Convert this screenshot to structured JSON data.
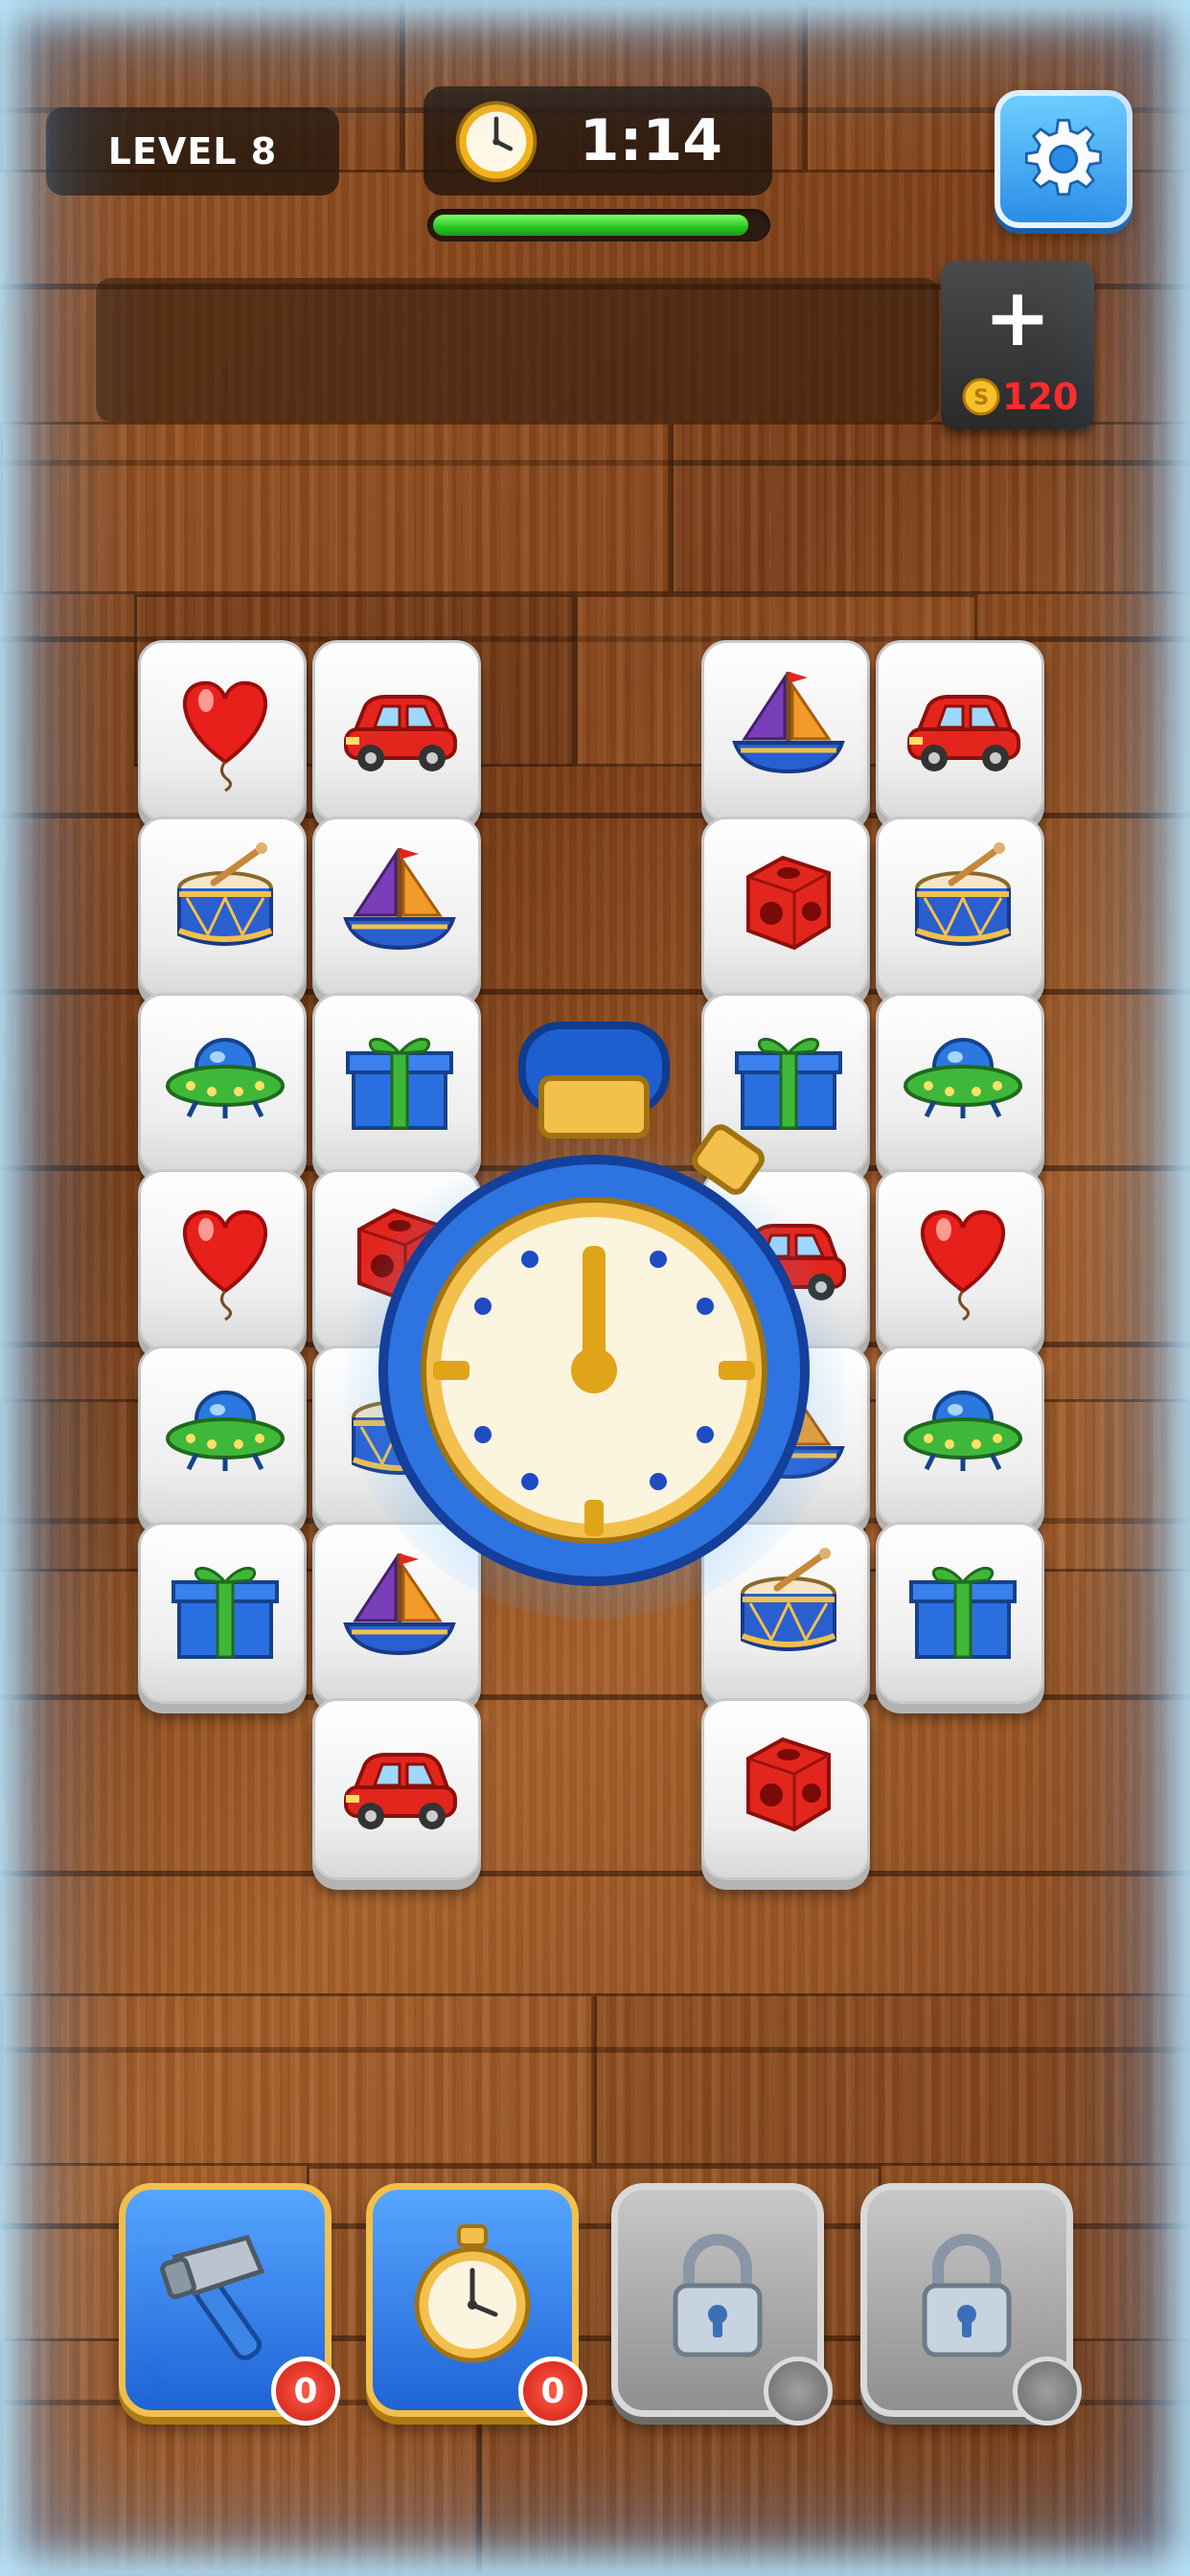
{
  "hud": {
    "level_label": "LEVEL 8",
    "timer_value": "1:14",
    "timer_progress": 0.95,
    "timer_icon": "clock-icon",
    "settings_icon": "gear-icon"
  },
  "slot_tray": {
    "add_slot_icon": "plus-icon",
    "coin_icon": "coin-icon",
    "coin_symbol": "S",
    "add_slot_cost": "120"
  },
  "board": {
    "left_grid": [
      [
        "heart-balloon",
        "red-car"
      ],
      [
        "drum",
        "sailboat"
      ],
      [
        "ufo",
        "gift-box"
      ],
      [
        "heart-balloon",
        "red-cube"
      ],
      [
        "ufo",
        "drum"
      ],
      [
        "gift-box",
        "sailboat"
      ],
      [
        null,
        "red-car"
      ]
    ],
    "right_grid": [
      [
        "sailboat",
        "red-car"
      ],
      [
        "red-cube",
        "drum"
      ],
      [
        "gift-box",
        "ufo"
      ],
      [
        "red-car",
        "heart-balloon"
      ],
      [
        "sailboat",
        "ufo"
      ],
      [
        "drum",
        "gift-box"
      ],
      [
        "red-cube",
        null
      ]
    ],
    "center_overlay": "stopwatch-freeze-icon"
  },
  "boosters": [
    {
      "name": "hammer",
      "icon": "hammer-icon",
      "count": "0",
      "locked": false
    },
    {
      "name": "freeze-time",
      "icon": "stopwatch-icon",
      "count": "0",
      "locked": false
    },
    {
      "name": "locked-1",
      "icon": "lock-icon",
      "count": "",
      "locked": true
    },
    {
      "name": "locked-2",
      "icon": "lock-icon",
      "count": "",
      "locked": true
    }
  ],
  "colors": {
    "timer_fill": "#27c421",
    "booster_blue": "#2f7ce8",
    "booster_border": "#f2c04b",
    "badge_red": "#d01e12",
    "cost_red": "#ff2a2a"
  }
}
